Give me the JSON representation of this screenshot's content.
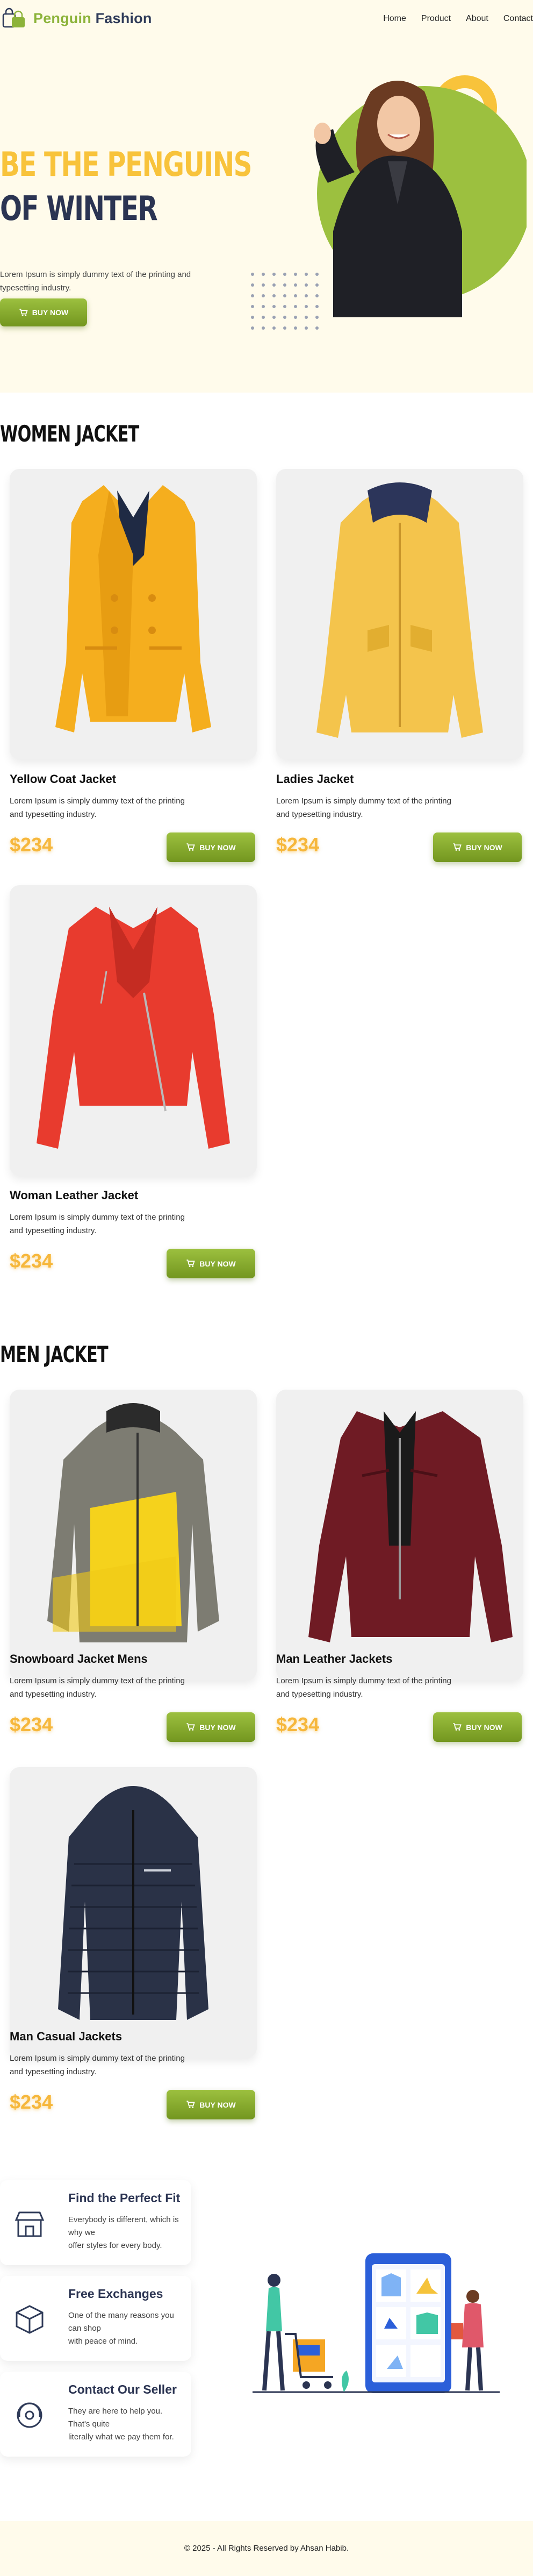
{
  "header": {
    "brand_part1": "Penguin",
    "brand_part2": "Fashion",
    "nav": [
      "Home",
      "Product",
      "About",
      "Contact"
    ]
  },
  "hero": {
    "title_line1": "BE THE PENGUINS",
    "title_line2": "OF WINTER",
    "description": "Lorem Ipsum is simply dummy text of the printing and typesetting industry.",
    "button_label": "BUY NOW"
  },
  "women": {
    "section_title": "WOMEN JACKET",
    "products": [
      {
        "name": "Yellow Coat Jacket",
        "description": "Lorem Ipsum is simply dummy text of the printing and typesetting industry.",
        "price": "$234",
        "button": "BUY NOW"
      },
      {
        "name": "Ladies Jacket",
        "description": "Lorem Ipsum is simply dummy text of the printing and typesetting industry.",
        "price": "$234",
        "button": "BUY NOW"
      },
      {
        "name": "Woman Leather Jacket",
        "description": "Lorem Ipsum is simply dummy text of the printing and typesetting industry.",
        "price": "$234",
        "button": "BUY NOW"
      }
    ]
  },
  "men": {
    "section_title": "MEN JACKET",
    "products": [
      {
        "name": "Snowboard Jacket Mens",
        "description": "Lorem Ipsum is simply dummy text of the printing and typesetting industry.",
        "price": "$234",
        "button": "BUY NOW"
      },
      {
        "name": "Man Leather Jackets",
        "description": "Lorem Ipsum is simply dummy text of the printing and typesetting industry.",
        "price": "$234",
        "button": "BUY NOW"
      },
      {
        "name": "Man Casual Jackets",
        "description": "Lorem Ipsum is simply dummy text of the printing and typesetting industry.",
        "price": "$234",
        "button": "BUY NOW"
      }
    ]
  },
  "features": [
    {
      "title": "Find the Perfect Fit",
      "description": "Everybody is different, which is why we\noffer styles for every body.",
      "icon": "store-icon"
    },
    {
      "title": "Free Exchanges",
      "description": "One of the many reasons you can shop\nwith peace of mind.",
      "icon": "box-icon"
    },
    {
      "title": "Contact Our Seller",
      "description": "They are here to help you. That's quite\nliterally what we pay them for.",
      "icon": "support-icon"
    }
  ],
  "footer": {
    "copyright": "© 2025 - All Rights Reserved by Ahsan Habib."
  },
  "colors": {
    "accent_green": "#8cb33a",
    "accent_yellow": "#f8c33b",
    "navy": "#2b3452",
    "cream_bg": "#fffbeb",
    "price": "#f6b73c"
  }
}
